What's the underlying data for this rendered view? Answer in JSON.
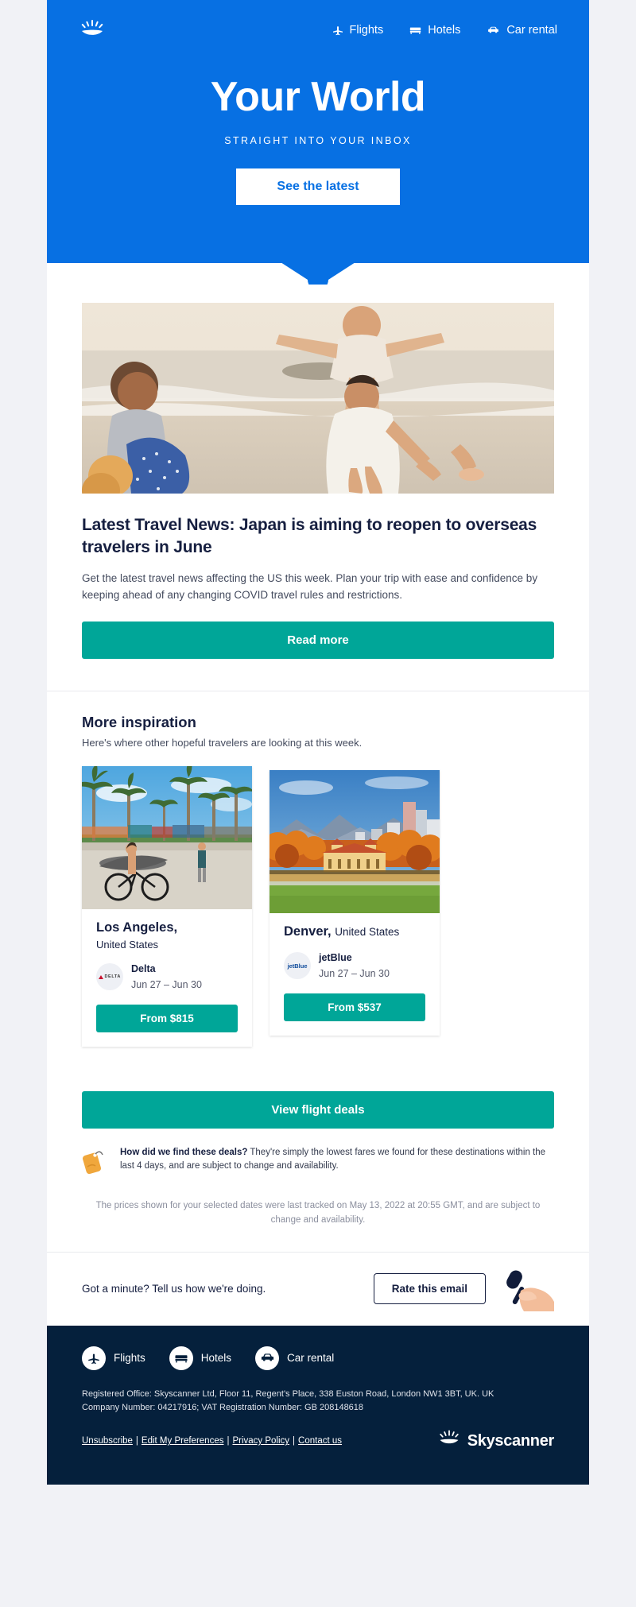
{
  "hero": {
    "logo_icon": "skyscanner-sunburst-icon",
    "nav": [
      {
        "label": "Flights",
        "icon": "airplane-icon"
      },
      {
        "label": "Hotels",
        "icon": "bed-icon"
      },
      {
        "label": "Car rental",
        "icon": "car-icon"
      }
    ],
    "title": "Your World",
    "subtitle": "STRAIGHT INTO YOUR INBOX",
    "cta_label": "See the latest",
    "bg_color": "#0770E3",
    "cta_text_color": "#0770E3"
  },
  "article": {
    "image_alt": "family-on-beach-photo",
    "headline": "Latest Travel News: Japan is aiming to reopen to overseas travelers in June",
    "body": "Get the latest travel news affecting the US this week. Plan your trip with ease and confidence by keeping ahead of any changing COVID travel rules and restrictions.",
    "cta_label": "Read more",
    "cta_color": "#00A698"
  },
  "inspiration": {
    "heading": "More inspiration",
    "subheading": "Here's where other hopeful travelers are looking at this week.",
    "cards": [
      {
        "image_alt": "venice-beach-boardwalk-photo",
        "city": "Los Angeles,",
        "country": "United States",
        "airline": "Delta",
        "airline_logo": "delta-logo-icon",
        "dates": "Jun 27 – Jun 30",
        "price_label": "From $815"
      },
      {
        "image_alt": "denver-city-park-autumn-photo",
        "city": "Denver,",
        "country": "United States",
        "airline": "jetBlue",
        "airline_logo": "jetblue-logo-icon",
        "dates": "Jun 27 – Jun 30",
        "price_label": "From $537"
      }
    ],
    "view_deals_label": "View flight deals",
    "how_did_we_find_icon": "price-tag-icon",
    "how_did_we_find_bold": "How did we find these deals?",
    "how_did_we_find_rest": " They're simply the lowest fares we found for these destinations within the last 4 days, and are subject to change and availability.",
    "tracked_note": "The prices shown for your selected dates were last tracked on May 13, 2022 at 20:55 GMT, and are subject to change and availability."
  },
  "rate": {
    "prompt": "Got a minute? Tell us how we're doing.",
    "button_label": "Rate this email",
    "illustration_icon": "hand-holding-microphone-icon"
  },
  "footer": {
    "bg_color": "#05203C",
    "nav": [
      {
        "label": "Flights",
        "icon": "airplane-icon"
      },
      {
        "label": "Hotels",
        "icon": "bed-icon"
      },
      {
        "label": "Car rental",
        "icon": "car-icon"
      }
    ],
    "legal_line1": "Registered Office: Skyscanner Ltd, Floor 11, Regent's Place, 338 Euston Road, London NW1 3BT, UK. UK",
    "legal_line2": "Company Number: 04217916; VAT Registration Number: GB 208148618",
    "links": [
      {
        "label": "Unsubscribe"
      },
      {
        "label": "Edit My Preferences"
      },
      {
        "label": "Privacy Policy"
      },
      {
        "label": "Contact us"
      }
    ],
    "link_separator": "|",
    "brand_name": "Skyscanner",
    "brand_icon": "skyscanner-sunburst-icon"
  }
}
